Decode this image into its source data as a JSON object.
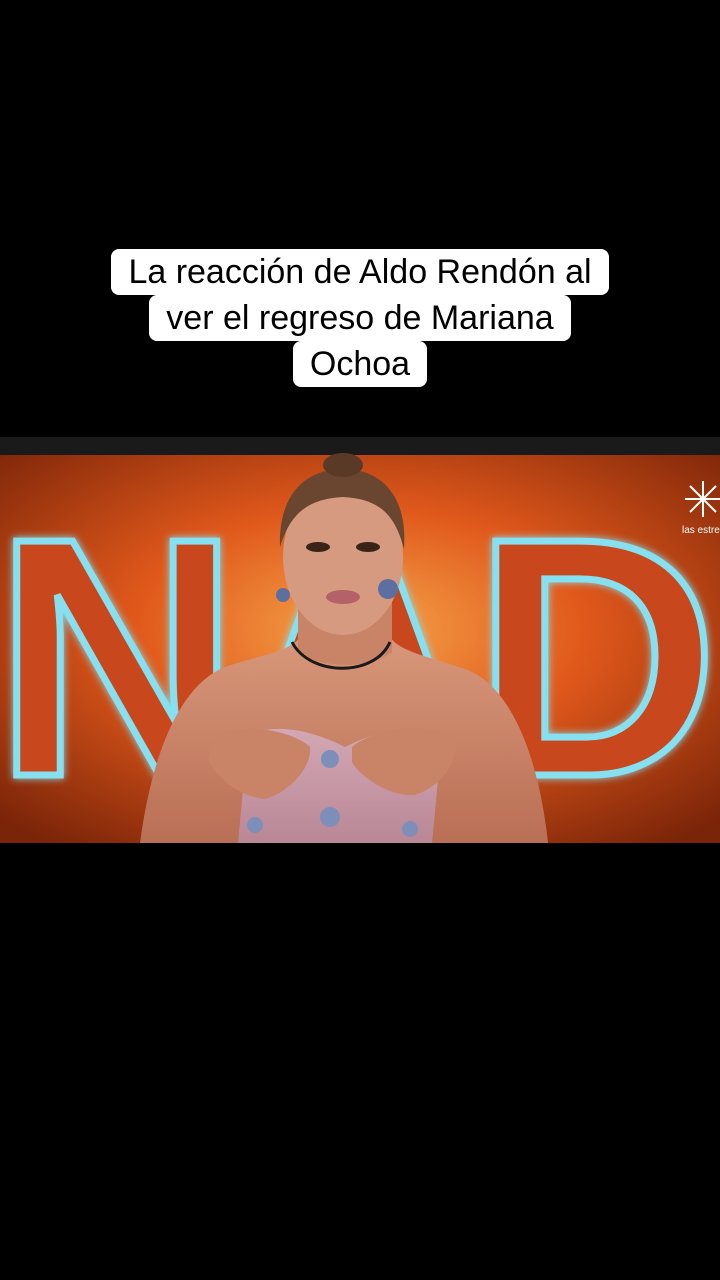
{
  "caption": {
    "lines": [
      "La reacción de Aldo Rendón al",
      "ver el regreso de Mariana",
      "Ochoa"
    ]
  },
  "video": {
    "background_sign_text": "NAD",
    "channel_logo_text": "las estrel",
    "colors": {
      "background": "#000000",
      "stage_orange": "#e0581b",
      "neon_outline": "#7fd4e8",
      "dress": "#c99aa8"
    }
  }
}
